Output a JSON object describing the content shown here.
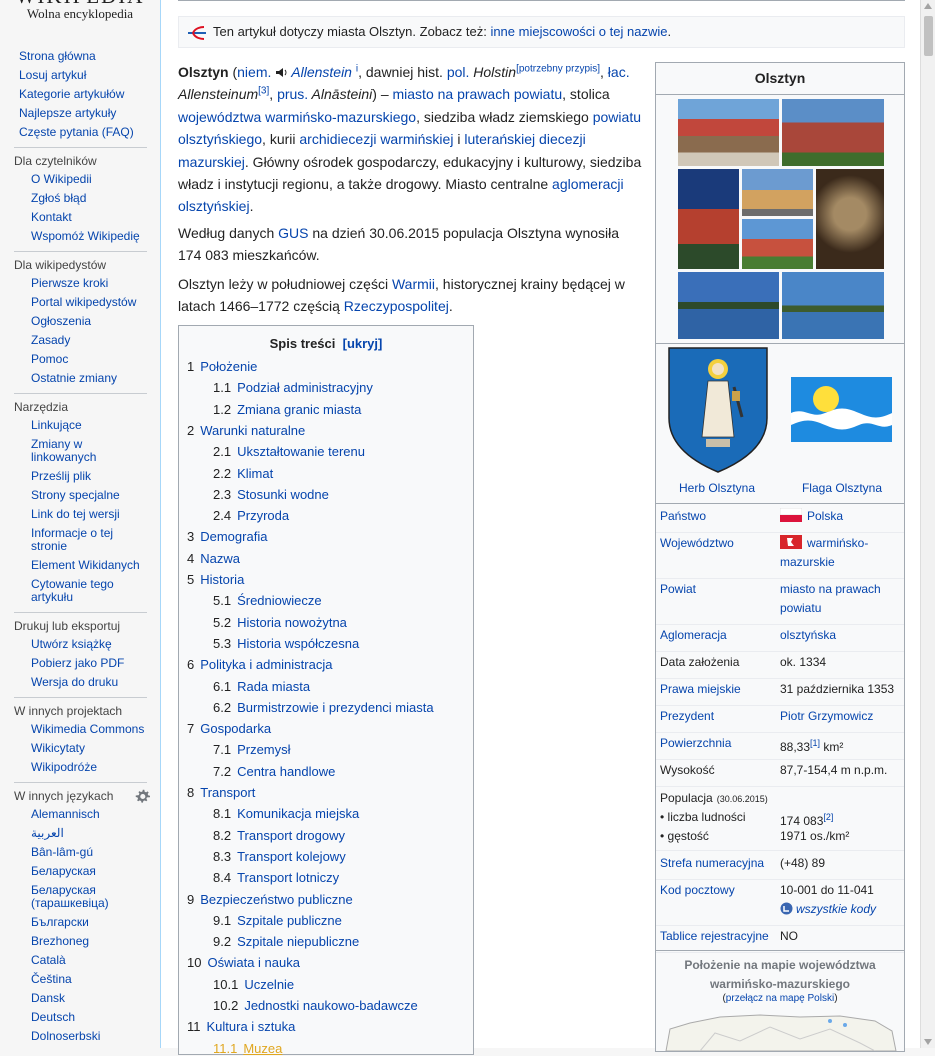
{
  "logo": {
    "title": "WIKIPEDIA",
    "tagline": "Wolna encyklopedia"
  },
  "sidebar": {
    "main": [
      "Strona główna",
      "Losuj artykuł",
      "Kategorie artykułów",
      "Najlepsze artykuły",
      "Częste pytania (FAQ)"
    ],
    "sections": [
      {
        "heading": "Dla czytelników",
        "items": [
          "O Wikipedii",
          "Zgłoś błąd",
          "Kontakt",
          "Wspomóż Wikipedię"
        ]
      },
      {
        "heading": "Dla wikipedystów",
        "items": [
          "Pierwsze kroki",
          "Portal wikipedystów",
          "Ogłoszenia",
          "Zasady",
          "Pomoc",
          "Ostatnie zmiany"
        ]
      },
      {
        "heading": "Narzędzia",
        "items": [
          "Linkujące",
          "Zmiany w linkowanych",
          "Prześlij plik",
          "Strony specjalne",
          "Link do tej wersji",
          "Informacje o tej stronie",
          "Element Wikidanych",
          "Cytowanie tego artykułu"
        ]
      },
      {
        "heading": "Drukuj lub eksportuj",
        "items": [
          "Utwórz książkę",
          "Pobierz jako PDF",
          "Wersja do druku"
        ]
      },
      {
        "heading": "W innych projektach",
        "items": [
          "Wikimedia Commons",
          "Wikicytaty",
          "Wikipodróże"
        ]
      },
      {
        "heading": "W innych językach",
        "items": [
          "Alemannisch",
          "العربية",
          "Bân-lâm-gú",
          "Беларуская",
          "Беларуская (тарашкевіца)",
          "Български",
          "Brezhoneg",
          "Català",
          "Čeština",
          "Dansk",
          "Deutsch",
          "Dolnoserbski"
        ]
      }
    ]
  },
  "hatnote": {
    "text": "Ten artykuł dotyczy miasta Olsztyn. Zobacz też: ",
    "link": "inne miejscowości o tej nazwie",
    "end": "."
  },
  "intro": {
    "p1": [
      {
        "b": "Olsztyn"
      },
      {
        "t": " ("
      },
      {
        "a": "niem."
      },
      {
        "t": " "
      },
      {
        "audio": "speaker-icon"
      },
      {
        "i": "Allenstein"
      },
      {
        "t": " "
      },
      {
        "sup": "i"
      },
      {
        "t": ", dawniej hist. "
      },
      {
        "a": "pol."
      },
      {
        "ip": " Holstin"
      },
      {
        "sup": "[potrzebny przypis]"
      },
      {
        "t": ", "
      },
      {
        "a": "łac."
      },
      {
        "ip": " Allensteinum"
      },
      {
        "sup": "[3]"
      },
      {
        "t": ", "
      },
      {
        "a": "prus."
      },
      {
        "ip": " Alnāsteini"
      },
      {
        "t": ") – "
      },
      {
        "a": "miasto na prawach powiatu"
      },
      {
        "t": ", stolica "
      },
      {
        "a": "województwa warmińsko-mazurskiego"
      },
      {
        "t": ", siedziba władz ziemskiego "
      },
      {
        "a": "powiatu olsztyńskiego"
      },
      {
        "t": ", kurii "
      },
      {
        "a": "archidiecezji warmińskiej"
      },
      {
        "t": " i "
      },
      {
        "a": "luterańskiej diecezji mazurskiej"
      },
      {
        "t": ". Główny ośrodek gospodarczy, edukacyjny i kulturowy, siedziba władz i instytucji regionu, a także drogowy. Miasto centralne "
      },
      {
        "a": "aglomeracji olsztyńskiej"
      },
      {
        "t": "."
      }
    ],
    "p2": [
      {
        "t": "Według danych "
      },
      {
        "a": "GUS"
      },
      {
        "t": " na dzień 30.06.2015 populacja Olsztyna wynosiła 174 083 mieszkańców."
      }
    ],
    "p3": [
      {
        "t": "Olsztyn leży w południowej części "
      },
      {
        "a": "Warmii"
      },
      {
        "t": ", historycznej krainy będącej w latach 1466–1772 częścią "
      },
      {
        "a": "Rzeczypospolitej"
      },
      {
        "t": "."
      }
    ]
  },
  "toc": {
    "title": "Spis treści",
    "toggle": "[ukryj]",
    "items": [
      {
        "n": "1",
        "t": "Położenie",
        "lvl": 1
      },
      {
        "n": "1.1",
        "t": "Podział administracyjny",
        "lvl": 2
      },
      {
        "n": "1.2",
        "t": "Zmiana granic miasta",
        "lvl": 2
      },
      {
        "n": "2",
        "t": "Warunki naturalne",
        "lvl": 1
      },
      {
        "n": "2.1",
        "t": "Ukształtowanie terenu",
        "lvl": 2
      },
      {
        "n": "2.2",
        "t": "Klimat",
        "lvl": 2
      },
      {
        "n": "2.3",
        "t": "Stosunki wodne",
        "lvl": 2
      },
      {
        "n": "2.4",
        "t": "Przyroda",
        "lvl": 2
      },
      {
        "n": "3",
        "t": "Demografia",
        "lvl": 1
      },
      {
        "n": "4",
        "t": "Nazwa",
        "lvl": 1
      },
      {
        "n": "5",
        "t": "Historia",
        "lvl": 1
      },
      {
        "n": "5.1",
        "t": "Średniowiecze",
        "lvl": 2
      },
      {
        "n": "5.2",
        "t": "Historia nowożytna",
        "lvl": 2
      },
      {
        "n": "5.3",
        "t": "Historia współczesna",
        "lvl": 2
      },
      {
        "n": "6",
        "t": "Polityka i administracja",
        "lvl": 1
      },
      {
        "n": "6.1",
        "t": "Rada miasta",
        "lvl": 2
      },
      {
        "n": "6.2",
        "t": "Burmistrzowie i prezydenci miasta",
        "lvl": 2
      },
      {
        "n": "7",
        "t": "Gospodarka",
        "lvl": 1
      },
      {
        "n": "7.1",
        "t": "Przemysł",
        "lvl": 2
      },
      {
        "n": "7.2",
        "t": "Centra handlowe",
        "lvl": 2
      },
      {
        "n": "8",
        "t": "Transport",
        "lvl": 1
      },
      {
        "n": "8.1",
        "t": "Komunikacja miejska",
        "lvl": 2
      },
      {
        "n": "8.2",
        "t": "Transport drogowy",
        "lvl": 2
      },
      {
        "n": "8.3",
        "t": "Transport kolejowy",
        "lvl": 2
      },
      {
        "n": "8.4",
        "t": "Transport lotniczy",
        "lvl": 2
      },
      {
        "n": "9",
        "t": "Bezpieczeństwo publiczne",
        "lvl": 1
      },
      {
        "n": "9.1",
        "t": "Szpitale publiczne",
        "lvl": 2
      },
      {
        "n": "9.2",
        "t": "Szpitale niepubliczne",
        "lvl": 2
      },
      {
        "n": "10",
        "t": "Oświata i nauka",
        "lvl": 1
      },
      {
        "n": "10.1",
        "t": "Uczelnie",
        "lvl": 2
      },
      {
        "n": "10.2",
        "t": "Jednostki naukowo-badawcze",
        "lvl": 2
      },
      {
        "n": "11",
        "t": "Kultura i sztuka",
        "lvl": 1
      },
      {
        "n": "11.1",
        "t": "Muzea",
        "lvl": 2,
        "hover": true
      }
    ]
  },
  "infobox": {
    "title": "Olsztyn",
    "coat_caption": "Herb Olsztyna",
    "flag_caption": "Flaga Olsztyna",
    "rows": [
      {
        "label": "Państwo",
        "value": "Polska",
        "link_label": true,
        "link_value": true,
        "flag": "poland"
      },
      {
        "label": "Województwo",
        "value": "warmińsko-mazurskie",
        "link_label": true,
        "link_value": true,
        "flag": "voivodeship"
      },
      {
        "label": "Powiat",
        "value": "miasto na prawach powiatu",
        "link_label": true,
        "link_value": true
      },
      {
        "label": "Aglomeracja",
        "value": "olsztyńska",
        "link_label": true,
        "link_value": true
      },
      {
        "label": "Data założenia",
        "value": "ok. 1334",
        "link_label": false,
        "link_value": false
      },
      {
        "label": "Prawa miejskie",
        "value": "31 października 1353",
        "link_label": true,
        "link_value": false
      },
      {
        "label": "Prezydent",
        "value": "Piotr Grzymowicz",
        "link_label": true,
        "link_value": true
      },
      {
        "label": "Powierzchnia",
        "value": "88,33",
        "sup": "[1]",
        "unit": " km²",
        "link_label": true,
        "link_value": false
      },
      {
        "label": "Wysokość",
        "value": "87,7-154,4 m n.p.m.",
        "link_label": false,
        "link_value": false
      }
    ],
    "population": {
      "label": "Populacja",
      "date": "(30.06.2015)",
      "sub1": "• liczba ludności",
      "val1": "174 083",
      "sup1": "[2]",
      "sub2": "• gęstość",
      "val2": "1971 os./km²"
    },
    "rows2": [
      {
        "label": "Strefa numeracyjna",
        "value": "(+48) 89",
        "link_label": true
      },
      {
        "label": "Kod pocztowy",
        "value": "10-001 do 11-041",
        "extra": "wszystkie kody",
        "link_label": true
      },
      {
        "label": "Tablice rejestracyjne",
        "value": "NO",
        "link_label": true
      }
    ],
    "map": {
      "title": "Położenie na mapie województwa warmińsko-mazurskiego",
      "switch": "przełącz na mapę Polski",
      "switch_open": "(",
      "switch_close": ")"
    }
  },
  "colors": {
    "link": "#0645ad",
    "hover": "#e0a720",
    "border": "#a2a9b1",
    "sidebar": "#f6f6f6"
  }
}
